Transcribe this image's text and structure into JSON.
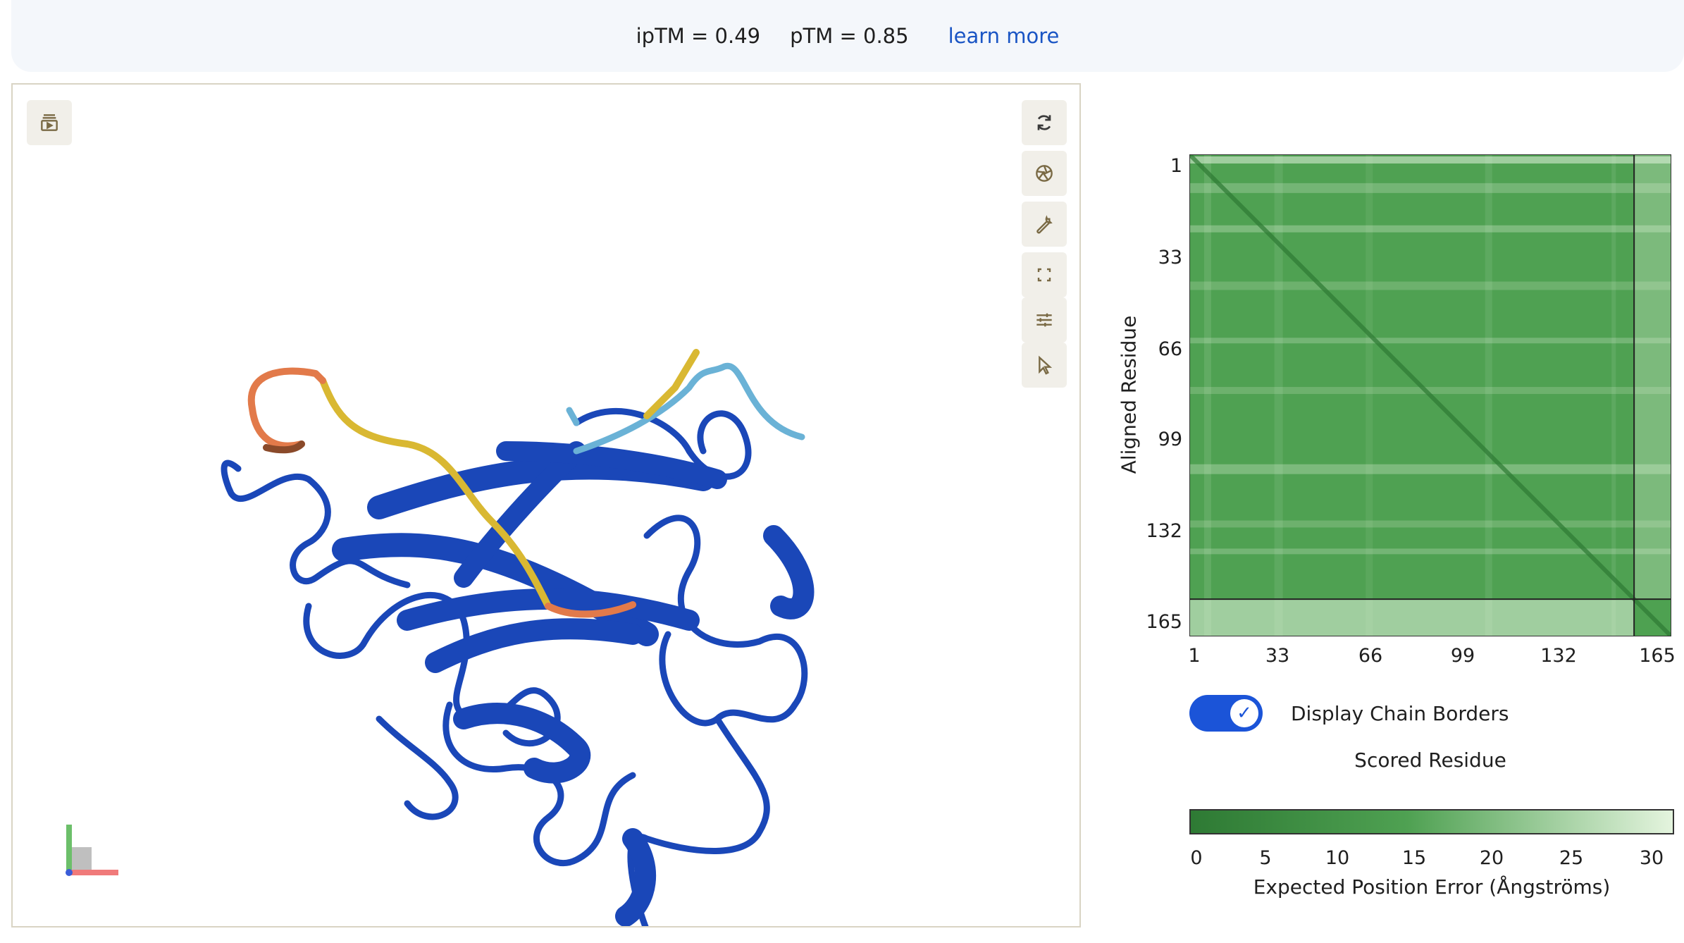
{
  "header": {
    "iptm": "ipTM = 0.49",
    "ptm": "pTM = 0.85",
    "learn_more": "learn more"
  },
  "viewer": {
    "toolbar_left": [
      {
        "name": "animation-icon"
      }
    ],
    "toolbar_right": [
      {
        "name": "rotate-icon"
      },
      {
        "name": "camera-shutter-icon"
      },
      {
        "name": "wrench-icon"
      },
      {
        "name": "fullscreen-icon"
      },
      {
        "name": "sliders-icon"
      },
      {
        "name": "cursor-icon"
      }
    ],
    "colors": {
      "chain_a": "#1a47b8",
      "plddt_orange": "#e27a4a",
      "plddt_yellow": "#d9b832",
      "plddt_lightblue": "#6ab2d6"
    }
  },
  "pae": {
    "ylabel": "Aligned Residue",
    "xlabel": "Scored Residue",
    "y_ticks": [
      "1",
      "33",
      "66",
      "99",
      "132",
      "165"
    ],
    "x_ticks": [
      "1",
      "33",
      "66",
      "99",
      "132",
      "165"
    ],
    "chain_border_label": "Display Chain Borders",
    "chain_border_on": true,
    "colorbar_ticks": [
      "0",
      "5",
      "10",
      "15",
      "20",
      "25",
      "30"
    ],
    "colorbar_title": "Expected Position Error (Ångströms)",
    "colors": {
      "low": "#2e7a34",
      "mid": "#4fa152",
      "high": "#e4f4de"
    }
  }
}
